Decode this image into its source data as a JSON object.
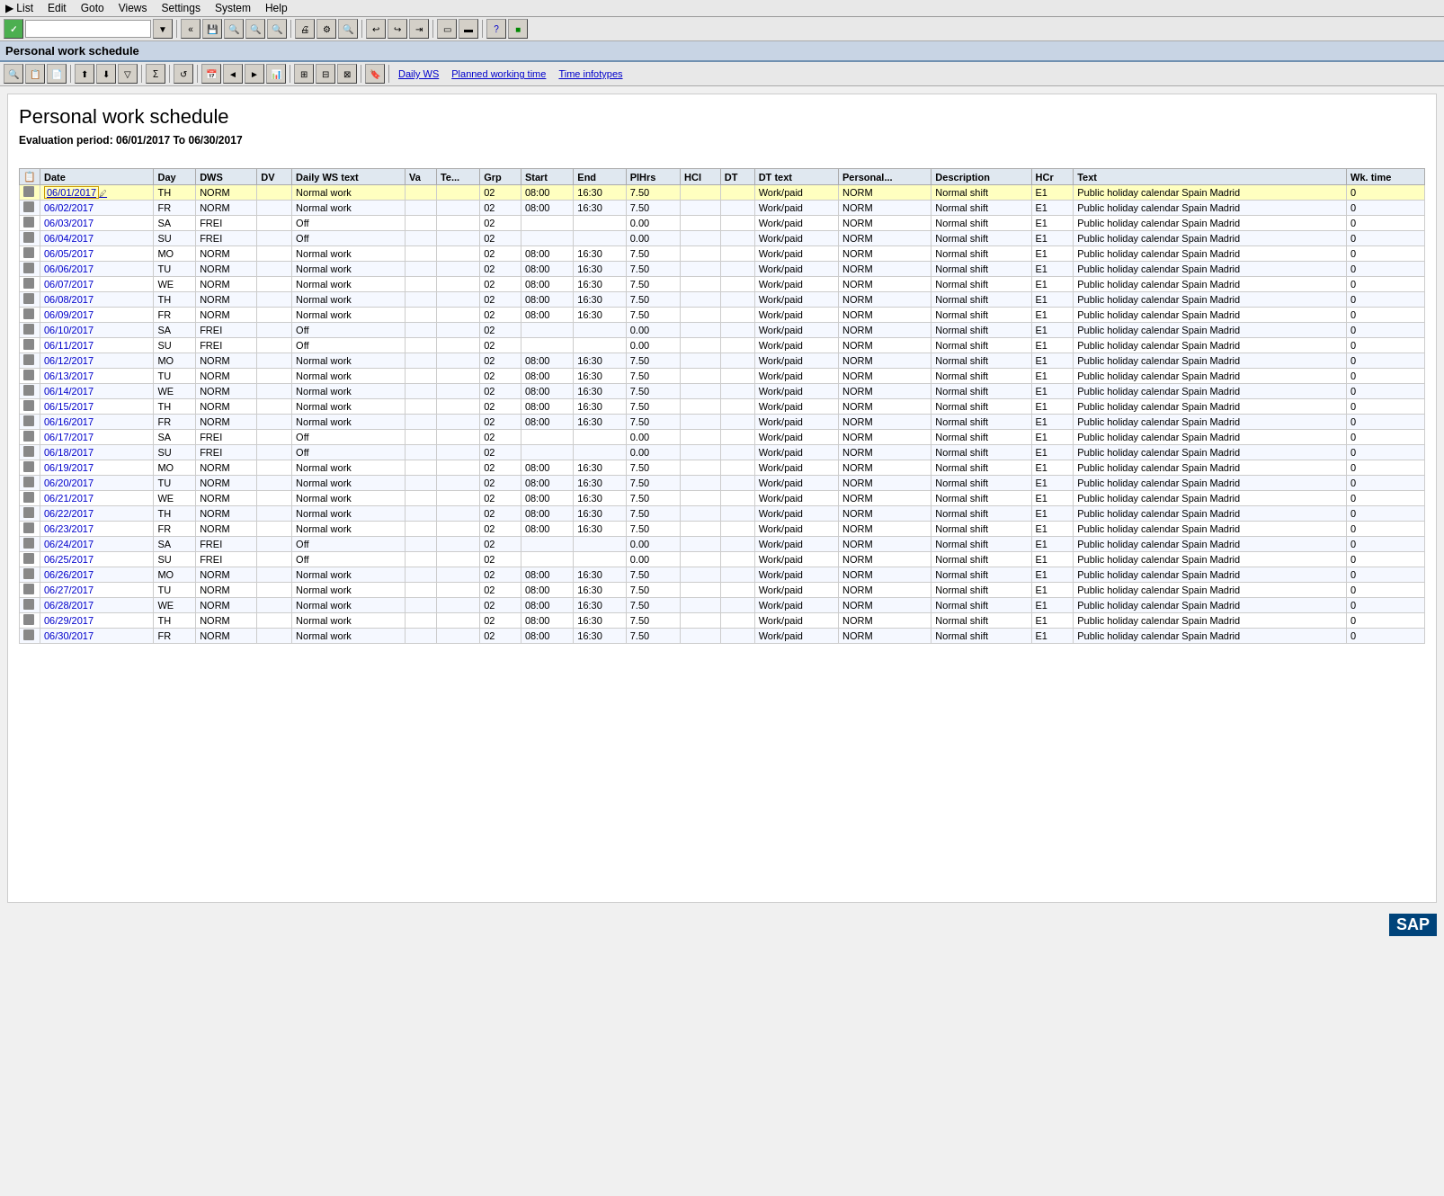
{
  "menu": {
    "items": [
      "List",
      "Edit",
      "Goto",
      "Views",
      "Settings",
      "System",
      "Help"
    ]
  },
  "toolbar2": {
    "title": "Personal work schedule"
  },
  "toolbar3": {
    "buttons": [
      "Daily WS",
      "Planned working time",
      "Time infotypes"
    ]
  },
  "page": {
    "title": "Personal work schedule",
    "eval_period": "Evaluation period: 06/01/2017 To 06/30/2017"
  },
  "table": {
    "headers": [
      "",
      "Date",
      "Day",
      "DWS",
      "DV",
      "Daily WS text",
      "Va",
      "Te...",
      "Grp",
      "Start",
      "End",
      "PlHrs",
      "HCl",
      "DT",
      "DT text",
      "Personal...",
      "Description",
      "HCr",
      "Text",
      "Wk. time"
    ],
    "rows": [
      [
        "",
        "06/01/2017",
        "TH",
        "NORM",
        "",
        "Normal work",
        "",
        "",
        "02",
        "08:00",
        "16:30",
        "7.50",
        "",
        "",
        "Work/paid",
        "NORM",
        "Normal shift",
        "E1",
        "Public holiday calendar Spain Madrid",
        "0"
      ],
      [
        "",
        "06/02/2017",
        "FR",
        "NORM",
        "",
        "Normal work",
        "",
        "",
        "02",
        "08:00",
        "16:30",
        "7.50",
        "",
        "",
        "Work/paid",
        "NORM",
        "Normal shift",
        "E1",
        "Public holiday calendar Spain Madrid",
        "0"
      ],
      [
        "",
        "06/03/2017",
        "SA",
        "FREI",
        "",
        "Off",
        "",
        "",
        "02",
        "",
        "",
        "0.00",
        "",
        "",
        "Work/paid",
        "NORM",
        "Normal shift",
        "E1",
        "Public holiday calendar Spain Madrid",
        "0"
      ],
      [
        "",
        "06/04/2017",
        "SU",
        "FREI",
        "",
        "Off",
        "",
        "",
        "02",
        "",
        "",
        "0.00",
        "",
        "",
        "Work/paid",
        "NORM",
        "Normal shift",
        "E1",
        "Public holiday calendar Spain Madrid",
        "0"
      ],
      [
        "",
        "06/05/2017",
        "MO",
        "NORM",
        "",
        "Normal work",
        "",
        "",
        "02",
        "08:00",
        "16:30",
        "7.50",
        "",
        "",
        "Work/paid",
        "NORM",
        "Normal shift",
        "E1",
        "Public holiday calendar Spain Madrid",
        "0"
      ],
      [
        "",
        "06/06/2017",
        "TU",
        "NORM",
        "",
        "Normal work",
        "",
        "",
        "02",
        "08:00",
        "16:30",
        "7.50",
        "",
        "",
        "Work/paid",
        "NORM",
        "Normal shift",
        "E1",
        "Public holiday calendar Spain Madrid",
        "0"
      ],
      [
        "",
        "06/07/2017",
        "WE",
        "NORM",
        "",
        "Normal work",
        "",
        "",
        "02",
        "08:00",
        "16:30",
        "7.50",
        "",
        "",
        "Work/paid",
        "NORM",
        "Normal shift",
        "E1",
        "Public holiday calendar Spain Madrid",
        "0"
      ],
      [
        "",
        "06/08/2017",
        "TH",
        "NORM",
        "",
        "Normal work",
        "",
        "",
        "02",
        "08:00",
        "16:30",
        "7.50",
        "",
        "",
        "Work/paid",
        "NORM",
        "Normal shift",
        "E1",
        "Public holiday calendar Spain Madrid",
        "0"
      ],
      [
        "",
        "06/09/2017",
        "FR",
        "NORM",
        "",
        "Normal work",
        "",
        "",
        "02",
        "08:00",
        "16:30",
        "7.50",
        "",
        "",
        "Work/paid",
        "NORM",
        "Normal shift",
        "E1",
        "Public holiday calendar Spain Madrid",
        "0"
      ],
      [
        "",
        "06/10/2017",
        "SA",
        "FREI",
        "",
        "Off",
        "",
        "",
        "02",
        "",
        "",
        "0.00",
        "",
        "",
        "Work/paid",
        "NORM",
        "Normal shift",
        "E1",
        "Public holiday calendar Spain Madrid",
        "0"
      ],
      [
        "",
        "06/11/2017",
        "SU",
        "FREI",
        "",
        "Off",
        "",
        "",
        "02",
        "",
        "",
        "0.00",
        "",
        "",
        "Work/paid",
        "NORM",
        "Normal shift",
        "E1",
        "Public holiday calendar Spain Madrid",
        "0"
      ],
      [
        "",
        "06/12/2017",
        "MO",
        "NORM",
        "",
        "Normal work",
        "",
        "",
        "02",
        "08:00",
        "16:30",
        "7.50",
        "",
        "",
        "Work/paid",
        "NORM",
        "Normal shift",
        "E1",
        "Public holiday calendar Spain Madrid",
        "0"
      ],
      [
        "",
        "06/13/2017",
        "TU",
        "NORM",
        "",
        "Normal work",
        "",
        "",
        "02",
        "08:00",
        "16:30",
        "7.50",
        "",
        "",
        "Work/paid",
        "NORM",
        "Normal shift",
        "E1",
        "Public holiday calendar Spain Madrid",
        "0"
      ],
      [
        "",
        "06/14/2017",
        "WE",
        "NORM",
        "",
        "Normal work",
        "",
        "",
        "02",
        "08:00",
        "16:30",
        "7.50",
        "",
        "",
        "Work/paid",
        "NORM",
        "Normal shift",
        "E1",
        "Public holiday calendar Spain Madrid",
        "0"
      ],
      [
        "",
        "06/15/2017",
        "TH",
        "NORM",
        "",
        "Normal work",
        "",
        "",
        "02",
        "08:00",
        "16:30",
        "7.50",
        "",
        "",
        "Work/paid",
        "NORM",
        "Normal shift",
        "E1",
        "Public holiday calendar Spain Madrid",
        "0"
      ],
      [
        "",
        "06/16/2017",
        "FR",
        "NORM",
        "",
        "Normal work",
        "",
        "",
        "02",
        "08:00",
        "16:30",
        "7.50",
        "",
        "",
        "Work/paid",
        "NORM",
        "Normal shift",
        "E1",
        "Public holiday calendar Spain Madrid",
        "0"
      ],
      [
        "",
        "06/17/2017",
        "SA",
        "FREI",
        "",
        "Off",
        "",
        "",
        "02",
        "",
        "",
        "0.00",
        "",
        "",
        "Work/paid",
        "NORM",
        "Normal shift",
        "E1",
        "Public holiday calendar Spain Madrid",
        "0"
      ],
      [
        "",
        "06/18/2017",
        "SU",
        "FREI",
        "",
        "Off",
        "",
        "",
        "02",
        "",
        "",
        "0.00",
        "",
        "",
        "Work/paid",
        "NORM",
        "Normal shift",
        "E1",
        "Public holiday calendar Spain Madrid",
        "0"
      ],
      [
        "",
        "06/19/2017",
        "MO",
        "NORM",
        "",
        "Normal work",
        "",
        "",
        "02",
        "08:00",
        "16:30",
        "7.50",
        "",
        "",
        "Work/paid",
        "NORM",
        "Normal shift",
        "E1",
        "Public holiday calendar Spain Madrid",
        "0"
      ],
      [
        "",
        "06/20/2017",
        "TU",
        "NORM",
        "",
        "Normal work",
        "",
        "",
        "02",
        "08:00",
        "16:30",
        "7.50",
        "",
        "",
        "Work/paid",
        "NORM",
        "Normal shift",
        "E1",
        "Public holiday calendar Spain Madrid",
        "0"
      ],
      [
        "",
        "06/21/2017",
        "WE",
        "NORM",
        "",
        "Normal work",
        "",
        "",
        "02",
        "08:00",
        "16:30",
        "7.50",
        "",
        "",
        "Work/paid",
        "NORM",
        "Normal shift",
        "E1",
        "Public holiday calendar Spain Madrid",
        "0"
      ],
      [
        "",
        "06/22/2017",
        "TH",
        "NORM",
        "",
        "Normal work",
        "",
        "",
        "02",
        "08:00",
        "16:30",
        "7.50",
        "",
        "",
        "Work/paid",
        "NORM",
        "Normal shift",
        "E1",
        "Public holiday calendar Spain Madrid",
        "0"
      ],
      [
        "",
        "06/23/2017",
        "FR",
        "NORM",
        "",
        "Normal work",
        "",
        "",
        "02",
        "08:00",
        "16:30",
        "7.50",
        "",
        "",
        "Work/paid",
        "NORM",
        "Normal shift",
        "E1",
        "Public holiday calendar Spain Madrid",
        "0"
      ],
      [
        "",
        "06/24/2017",
        "SA",
        "FREI",
        "",
        "Off",
        "",
        "",
        "02",
        "",
        "",
        "0.00",
        "",
        "",
        "Work/paid",
        "NORM",
        "Normal shift",
        "E1",
        "Public holiday calendar Spain Madrid",
        "0"
      ],
      [
        "",
        "06/25/2017",
        "SU",
        "FREI",
        "",
        "Off",
        "",
        "",
        "02",
        "",
        "",
        "0.00",
        "",
        "",
        "Work/paid",
        "NORM",
        "Normal shift",
        "E1",
        "Public holiday calendar Spain Madrid",
        "0"
      ],
      [
        "",
        "06/26/2017",
        "MO",
        "NORM",
        "",
        "Normal work",
        "",
        "",
        "02",
        "08:00",
        "16:30",
        "7.50",
        "",
        "",
        "Work/paid",
        "NORM",
        "Normal shift",
        "E1",
        "Public holiday calendar Spain Madrid",
        "0"
      ],
      [
        "",
        "06/27/2017",
        "TU",
        "NORM",
        "",
        "Normal work",
        "",
        "",
        "02",
        "08:00",
        "16:30",
        "7.50",
        "",
        "",
        "Work/paid",
        "NORM",
        "Normal shift",
        "E1",
        "Public holiday calendar Spain Madrid",
        "0"
      ],
      [
        "",
        "06/28/2017",
        "WE",
        "NORM",
        "",
        "Normal work",
        "",
        "",
        "02",
        "08:00",
        "16:30",
        "7.50",
        "",
        "",
        "Work/paid",
        "NORM",
        "Normal shift",
        "E1",
        "Public holiday calendar Spain Madrid",
        "0"
      ],
      [
        "",
        "06/29/2017",
        "TH",
        "NORM",
        "",
        "Normal work",
        "",
        "",
        "02",
        "08:00",
        "16:30",
        "7.50",
        "",
        "",
        "Work/paid",
        "NORM",
        "Normal shift",
        "E1",
        "Public holiday calendar Spain Madrid",
        "0"
      ],
      [
        "",
        "06/30/2017",
        "FR",
        "NORM",
        "",
        "Normal work",
        "",
        "",
        "02",
        "08:00",
        "16:30",
        "7.50",
        "",
        "",
        "Work/paid",
        "NORM",
        "Normal shift",
        "E1",
        "Public holiday calendar Spain Madrid",
        "0"
      ]
    ]
  }
}
